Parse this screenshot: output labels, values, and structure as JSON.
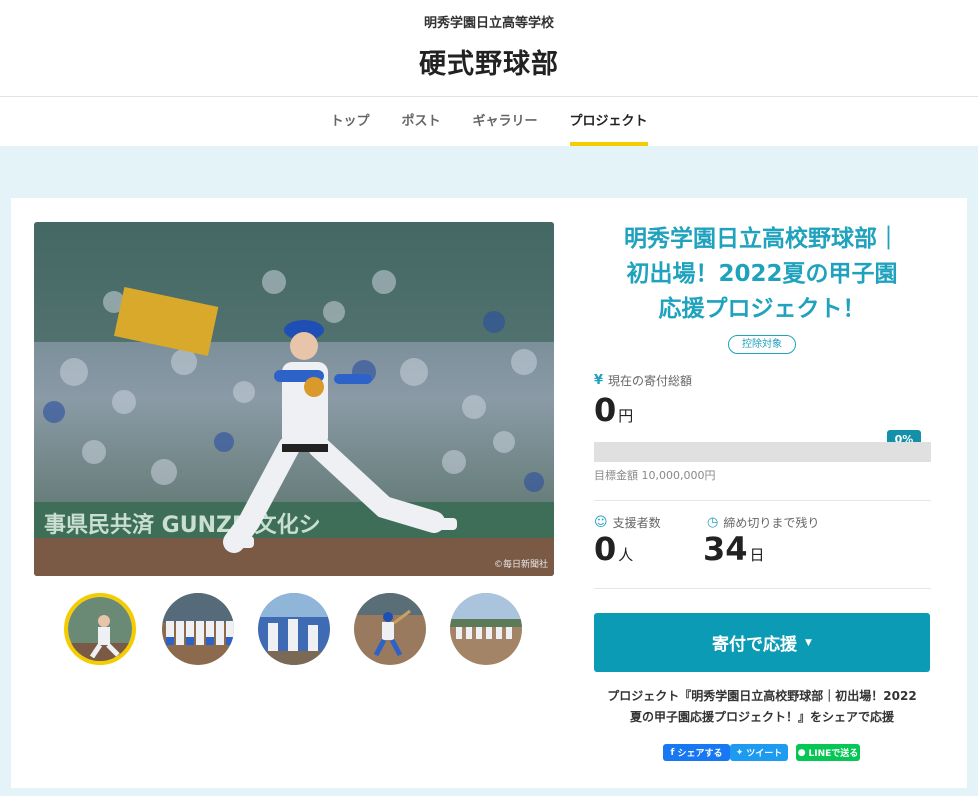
{
  "header": {
    "school_name": "明秀学園日立高等学校",
    "club_name": "硬式野球部"
  },
  "nav": {
    "items": [
      {
        "label": "トップ"
      },
      {
        "label": "ポスト"
      },
      {
        "label": "ギャラリー"
      },
      {
        "label": "プロジェクト"
      }
    ],
    "active": "プロジェクト"
  },
  "photo": {
    "credit": "©毎日新聞社"
  },
  "project": {
    "title_lines": [
      "明秀学園日立高校野球部｜",
      "初出場！2022夏の甲子園",
      "応援プロジェクト！"
    ],
    "badge": "控除対象",
    "amount_label": "現在の寄付総額",
    "amount_value": "0",
    "amount_unit": "円",
    "progress_percent": 0,
    "progress_label": "0%",
    "target_text": "目標金額 10,000,000円",
    "supporters_label": "支援者数",
    "supporters_value": "0",
    "supporters_unit": "人",
    "deadline_label": "締め切りまで残り",
    "deadline_value": "34",
    "deadline_unit": "日",
    "donate_button": "寄付で応援",
    "share_text_line1": "プロジェクト『明秀学園日立高校野球部｜初出場！2022",
    "share_text_line2": "夏の甲子園応援プロジェクト！』をシェアで応援"
  },
  "sns": {
    "facebook": "シェアする",
    "twitter": "ツイート",
    "line": "LINEで送る"
  },
  "colors": {
    "accent": "#1fa2bd",
    "button": "#0c9bb4",
    "highlight": "#f5cc00",
    "page_bg": "#e3f3f7"
  }
}
